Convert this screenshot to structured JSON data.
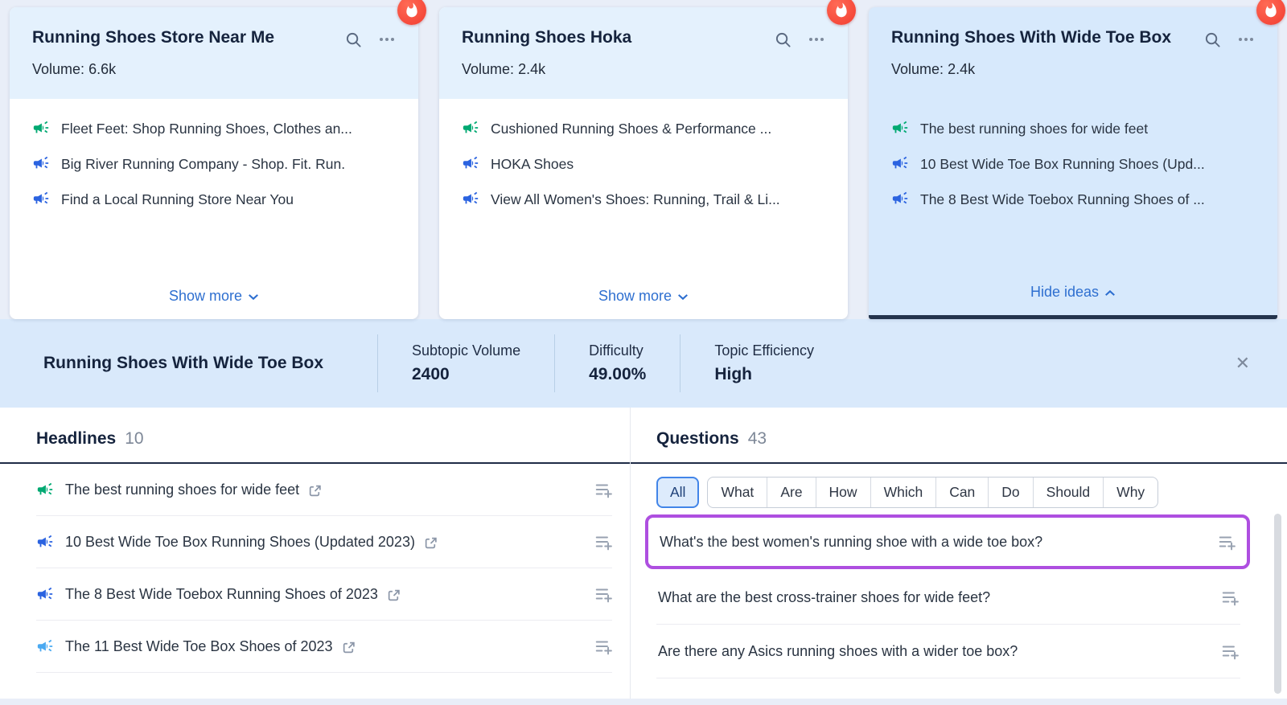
{
  "colors": {
    "accent_link": "#2e6fd0",
    "green_icon": "#00a972",
    "blue_icon": "#2b63e0",
    "lightblue_icon": "#4aa9f1",
    "highlight_purple": "#ae4fe0",
    "fire_badge_red": "#f23c30",
    "selected_card_bg": "#d7e9fc",
    "header_bg": "#e4f1fd"
  },
  "cards": [
    {
      "title": "Running Shoes Store Near Me",
      "volume_label": "Volume:",
      "volume": "6.6k",
      "ideas": [
        {
          "text": "Fleet Feet: Shop Running Shoes, Clothes an...",
          "color": "green"
        },
        {
          "text": "Big River Running Company - Shop. Fit. Run.",
          "color": "blue"
        },
        {
          "text": "Find a Local Running Store Near You",
          "color": "blue"
        }
      ],
      "footer_label": "Show more"
    },
    {
      "title": "Running Shoes Hoka",
      "volume_label": "Volume:",
      "volume": "2.4k",
      "ideas": [
        {
          "text": "Cushioned Running Shoes & Performance ...",
          "color": "green"
        },
        {
          "text": "HOKA Shoes",
          "color": "blue"
        },
        {
          "text": "View All Women's Shoes: Running, Trail & Li...",
          "color": "blue"
        }
      ],
      "footer_label": "Show more"
    },
    {
      "title": "Running Shoes With Wide Toe Box",
      "volume_label": "Volume:",
      "volume": "2.4k",
      "ideas": [
        {
          "text": "The best running shoes for wide feet",
          "color": "green"
        },
        {
          "text": "10 Best Wide Toe Box Running Shoes (Upd...",
          "color": "blue"
        },
        {
          "text": "The 8 Best Wide Toebox Running Shoes of ...",
          "color": "blue"
        }
      ],
      "footer_label": "Hide ideas"
    }
  ],
  "detail": {
    "title": "Running Shoes With Wide Toe Box",
    "stats": [
      {
        "label": "Subtopic Volume",
        "value": "2400"
      },
      {
        "label": "Difficulty",
        "value": "49.00%"
      },
      {
        "label": "Topic Efficiency",
        "value": "High"
      }
    ]
  },
  "headlines": {
    "title": "Headlines",
    "count": "10",
    "items": [
      {
        "text": "The best running shoes for wide feet",
        "color": "green"
      },
      {
        "text": "10 Best Wide Toe Box Running Shoes (Updated 2023)",
        "color": "blue"
      },
      {
        "text": "The 8 Best Wide Toebox Running Shoes of 2023",
        "color": "blue"
      },
      {
        "text": "The 11 Best Wide Toe Box Shoes of 2023",
        "color": "lightblue"
      }
    ]
  },
  "questions": {
    "title": "Questions",
    "count": "43",
    "active_filter": "All",
    "filters": [
      "All",
      "What",
      "Are",
      "How",
      "Which",
      "Can",
      "Do",
      "Should",
      "Why"
    ],
    "items": [
      {
        "text": "What's the best women's running shoe with a wide toe box?",
        "highlighted": true
      },
      {
        "text": "What are the best cross-trainer shoes for wide feet?",
        "highlighted": false
      },
      {
        "text": "Are there any Asics running shoes with a wider toe box?",
        "highlighted": false
      }
    ]
  }
}
